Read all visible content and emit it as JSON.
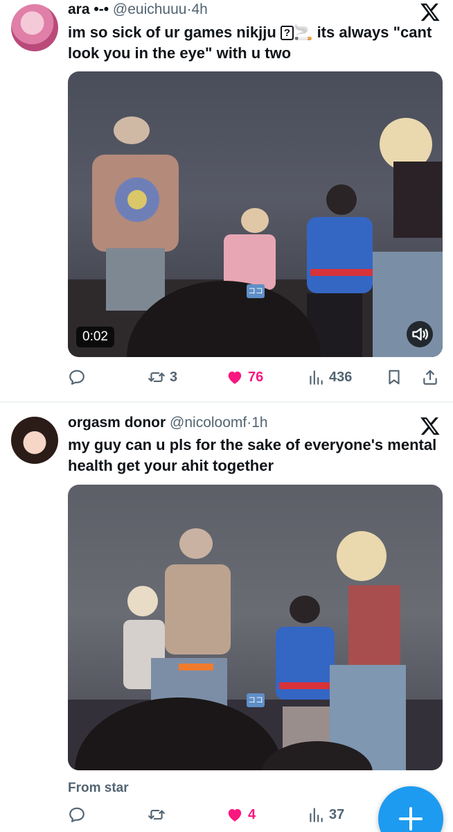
{
  "tweets": [
    {
      "display_name": "ara •-•",
      "handle": "@euichuuu",
      "separator": "·",
      "time": "4h",
      "text_part1": "im so sick of ur games nikjju ",
      "text_box": "?",
      "text_emoji": "🚬",
      "text_part2": " its always \"cant look you in the eye\" with u two",
      "video_timer": "0:02",
      "media_badge": "ココ",
      "reply_count": "",
      "retweet_count": "3",
      "like_count": "76",
      "view_count": "436",
      "liked": true
    },
    {
      "display_name": "orgasm donor",
      "handle": "@nicoloomf",
      "separator": "·",
      "time": "1h",
      "text": "my guy can u pls for the sake of everyone's mental health get your ahit together",
      "media_badge": "ココ",
      "from_label": "From star",
      "reply_count": "",
      "retweet_count": "",
      "like_count": "4",
      "view_count": "37",
      "liked": true
    }
  ],
  "icons": {
    "platform": "x-logo-icon",
    "reply": "reply-icon",
    "retweet": "retweet-icon",
    "like": "heart-icon",
    "views": "views-icon",
    "bookmark": "bookmark-icon",
    "share": "share-icon",
    "compose": "plus-icon",
    "volume": "volume-icon"
  },
  "colors": {
    "like": "#f91880",
    "muted": "#536471",
    "text": "#0f1419",
    "accent": "#1d9bf0"
  }
}
